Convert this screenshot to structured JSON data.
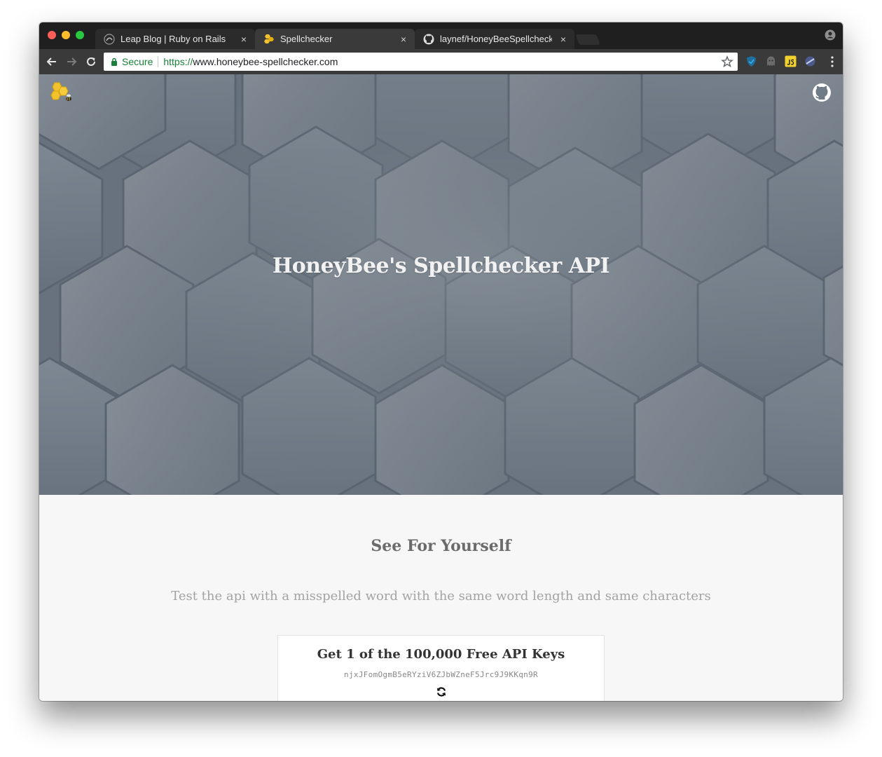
{
  "browser": {
    "tabs": [
      {
        "title": "Leap Blog | Ruby on Rails",
        "favicon": "leap-logo-icon",
        "active": false
      },
      {
        "title": "Spellchecker",
        "favicon": "honeycomb-bee-icon",
        "active": true
      },
      {
        "title": "laynef/HoneyBeeSpellchecker",
        "favicon": "github-icon",
        "active": false
      }
    ],
    "close_glyph": "×",
    "address_bar": {
      "secure_label": "Secure",
      "url_scheme": "https://",
      "url_rest": "www.honeybee-spellchecker.com"
    }
  },
  "hero": {
    "title": "HoneyBee's Spellchecker API",
    "logo": "honeycomb-bee-icon",
    "github": "github-icon"
  },
  "section": {
    "title": "See For Yourself",
    "subtitle": "Test the api with a misspelled word with the same word length and same characters"
  },
  "card": {
    "title": "Get 1 of the 100,000 Free API Keys",
    "api_key": "njxJFomOgmB5eRYziV6ZJbWZneF5Jrc9J9KKqn9R",
    "refresh": "refresh-icon"
  },
  "colors": {
    "hero_bg": "#6f7b86",
    "page_bg": "#f7f7f7",
    "secure_green": "#188038",
    "honey": "#f2c12e"
  }
}
